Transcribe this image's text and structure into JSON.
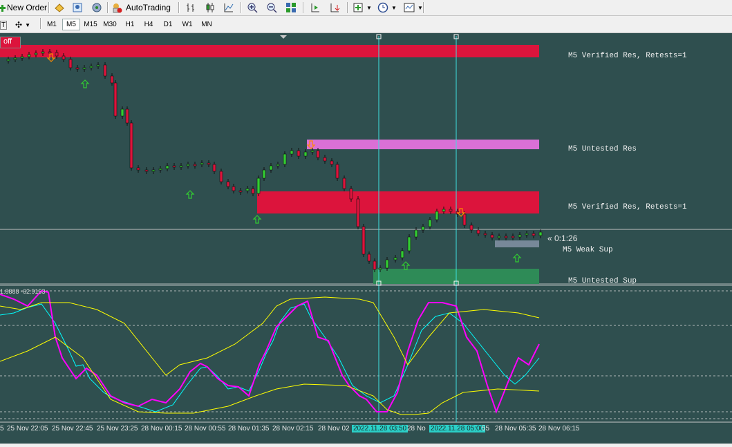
{
  "toolbar": {
    "new_order_label": "New Order",
    "autotrading_label": "AutoTrading",
    "icons": [
      "new-order-icon",
      "market-watch-icon",
      "signal-icon",
      "autotrading-icon",
      "bar-chart-icon",
      "candles-icon",
      "line-chart-icon",
      "zoom-in-icon",
      "zoom-out-icon",
      "tile-icon",
      "shift-icon",
      "autoscroll-icon",
      "indicators-icon",
      "periods-icon",
      "templates-icon"
    ]
  },
  "timeframes": [
    "M1",
    "M5",
    "M15",
    "M30",
    "H1",
    "H4",
    "D1",
    "W1",
    "MN"
  ],
  "active_timeframe": "M5",
  "chart": {
    "off_badge": "off",
    "zones": [
      {
        "label": "M5 Verified Res, Retests=1",
        "color": "#dc143c"
      },
      {
        "label": "M5 Untested Res",
        "color": "#da70d6"
      },
      {
        "label": "M5 Verified Res, Retests=1",
        "color": "#dc143c"
      },
      {
        "label": "M5 Weak Sup",
        "color": "#778899"
      },
      {
        "label": "M5 Untested Sup",
        "color": "#2e8b57"
      }
    ],
    "countdown": "« 0:1:26",
    "indicator_label": "1.8888 -62.9153",
    "x_labels": [
      "5",
      "25 Nov 22:05",
      "25 Nov 22:45",
      "25 Nov 23:25",
      "28 Nov 00:15",
      "28 Nov 00:55",
      "28 Nov 01:35",
      "28 Nov 02:15",
      "28 Nov 02",
      "2022.11.28 03:50",
      "28 No",
      "2022.11.28 05:00",
      "55",
      "28 Nov 05:35",
      "28 Nov 06:15"
    ]
  },
  "colors": {
    "background": "#2f4f4f",
    "bull_candle": "#32cd32",
    "bear_candle": "#dc143c",
    "stoch_main": "#ff00ff",
    "stoch_signal": "#00ffff",
    "band": "#ffff00"
  }
}
